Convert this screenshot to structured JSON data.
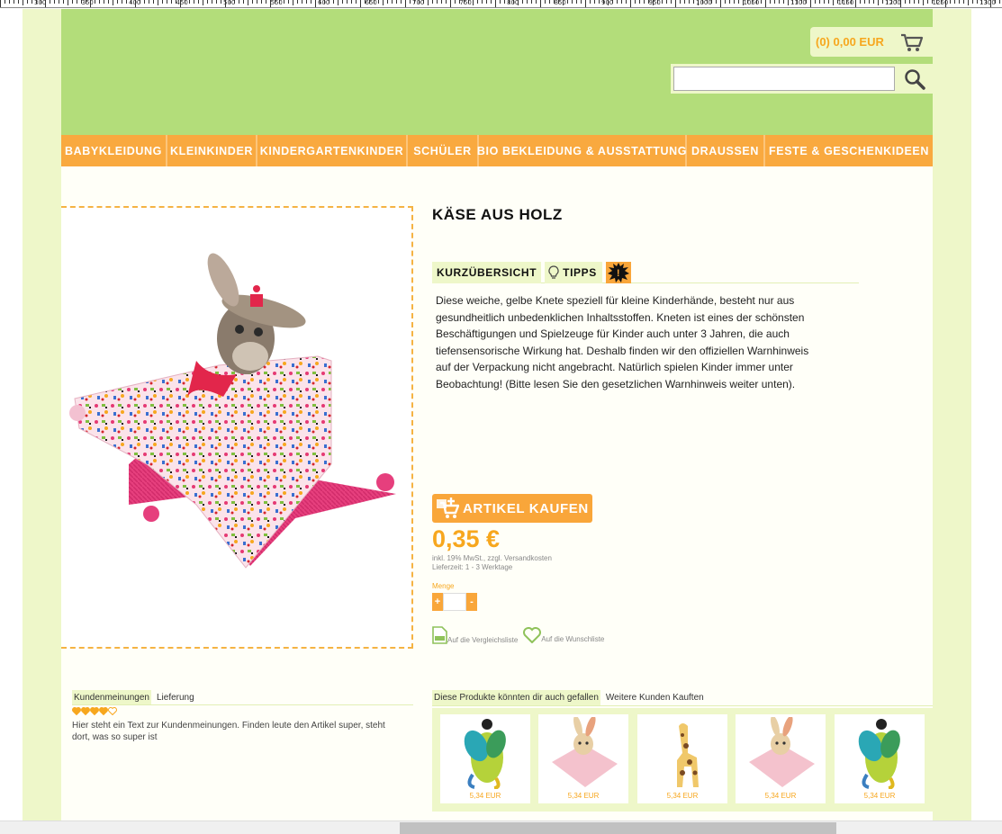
{
  "ruler": {
    "labels": [
      "300",
      "350",
      "400",
      "450",
      "500",
      "550",
      "600",
      "650",
      "700",
      "750",
      "800",
      "850",
      "900",
      "950",
      "1000",
      "1050",
      "1100",
      "1150",
      "1200",
      "1250",
      "1300"
    ]
  },
  "header": {
    "cart_text": "(0) 0,00 EUR",
    "search_placeholder": ""
  },
  "nav": {
    "items": [
      {
        "label": "BABYKLEIDUNG"
      },
      {
        "label": "KLEINKINDER"
      },
      {
        "label": "KINDERGARTENKINDER"
      },
      {
        "label": "SCHÜLER"
      },
      {
        "label": "BIO BEKLEIDUNG & AUSSTATTUNG"
      },
      {
        "label": "DRAUSSEN"
      },
      {
        "label": "FESTE & GESCHENKIDEEN"
      }
    ]
  },
  "product": {
    "title": "KÄSE AUS HOLZ",
    "tabs": {
      "overview": "KURZÜBERSICHT",
      "tips": "TIPPS",
      "warning_symbol": "!"
    },
    "description_lines": [
      "Diese weiche, gelbe Knete speziell für kleine Kinderhände, besteht nur aus",
      "gesundheitlich unbedenklichen Inhaltsstoffen. Kneten ist eines der schönsten",
      "Beschäftigungen und Spielzeuge für Kinder auch unter 3 Jahren, die auch",
      "tiefensensorische Wirkung hat. Deshalb finden wir den offiziellen Warnhinweis",
      "auf der Verpackung nicht angebracht. Natürlich spielen Kinder immer unter",
      "Beobachtung! (Bitte lesen Sie den gesetzlichen Warnhinweis weiter unten)."
    ],
    "buy_label": "ARTIKEL KAUFEN",
    "price": "0,35 €",
    "tax_note": "inkl. 19% MwSt., zzgl. Versandkosten",
    "delivery": "Lieferzeit: 1 - 3 Werktage",
    "quantity_label": "Menge",
    "plus": "+",
    "minus": "-",
    "quantity_value": "",
    "compare_label": "Auf die Vergleichsliste",
    "wishlist_label": "Auf die Wunschliste",
    "icons": {
      "image": "plush-bunny-comforter-image",
      "cart": "cart-icon",
      "search": "search-icon"
    }
  },
  "reviews": {
    "tabs": [
      {
        "label": "Kundenmeinungen"
      },
      {
        "label": "Lieferung"
      }
    ],
    "rating": 4,
    "rating_max": 5,
    "text": "Hier steht ein Text zur Kundenmeinungen. Finden leute den Artikel super, steht dort, was so super ist"
  },
  "recommendations": {
    "tabs": [
      {
        "label": "Diese Produkte könnten dir auch gefallen"
      },
      {
        "label": "Weitere Kunden Kauften"
      }
    ],
    "items": [
      {
        "kind": "bug",
        "price": "5,34 EUR"
      },
      {
        "kind": "bunny",
        "price": "5,34 EUR"
      },
      {
        "kind": "giraffe",
        "price": "5,34 EUR"
      },
      {
        "kind": "bunny",
        "price": "5,34 EUR"
      },
      {
        "kind": "bug",
        "price": "5,34 EUR"
      }
    ]
  },
  "colors": {
    "accent": "#f9a63a",
    "header_green": "#b3dd7a",
    "light_green": "#eef7c9",
    "price_orange": "#f7a71e"
  }
}
